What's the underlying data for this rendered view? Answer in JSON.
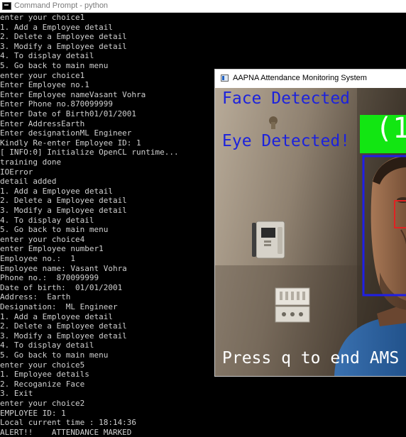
{
  "console_window": {
    "title": "Command Prompt - python",
    "lines": [
      "enter your choice1",
      "1. Add a Employee detail",
      "2. Delete a Employee detail",
      "3. Modify a Employee detail",
      "4. To display detail",
      "5. Go back to main menu",
      "enter your choice1",
      "Enter Employee no.1",
      "Enter Employee nameVasant Vohra",
      "Enter Phone no.870099999",
      "Enter Date of Birth01/01/2001",
      "Enter AddressEarth",
      "Enter designationML Engineer",
      "Kindly Re-enter Employee ID: 1",
      "[ INFO:0] Initialize OpenCL runtime...",
      "training done",
      "IOError",
      "detail added",
      "1. Add a Employee detail",
      "2. Delete a Employee detail",
      "3. Modify a Employee detail",
      "4. To display detail",
      "5. Go back to main menu",
      "enter your choice4",
      "enter Employee number1",
      "Employee no.:  1",
      "Employee name: Vasant Vohra",
      "Phone no.:  870099999",
      "Date of birth:  01/01/2001",
      "Address:  Earth",
      "Designation:  ML Engineer",
      "1. Add a Employee detail",
      "2. Delete a Employee detail",
      "3. Modify a Employee detail",
      "4. To display detail",
      "5. Go back to main menu",
      "enter your choice5",
      "1. Employee details",
      "2. Recoganize Face",
      "3. Exit",
      "enter your choice2",
      "EMPLOYEE ID: 1",
      "Local current time : 18:14:36",
      "ALERT!!    ATTENDANCE MARKED"
    ]
  },
  "camera_window": {
    "title": "AAPNA Attendance Monitoring System",
    "overlay": {
      "face_status": "Face Detected",
      "eye_status": "Eye Detected!",
      "counter": "(1",
      "instruction": "Press q to end AMS"
    },
    "colors": {
      "overlay_text": "#1c22dc",
      "instruction_text": "#ffffff",
      "counter_box": "#12e612",
      "face_box": "#1f1fe6",
      "eye_box": "#e02222"
    }
  }
}
